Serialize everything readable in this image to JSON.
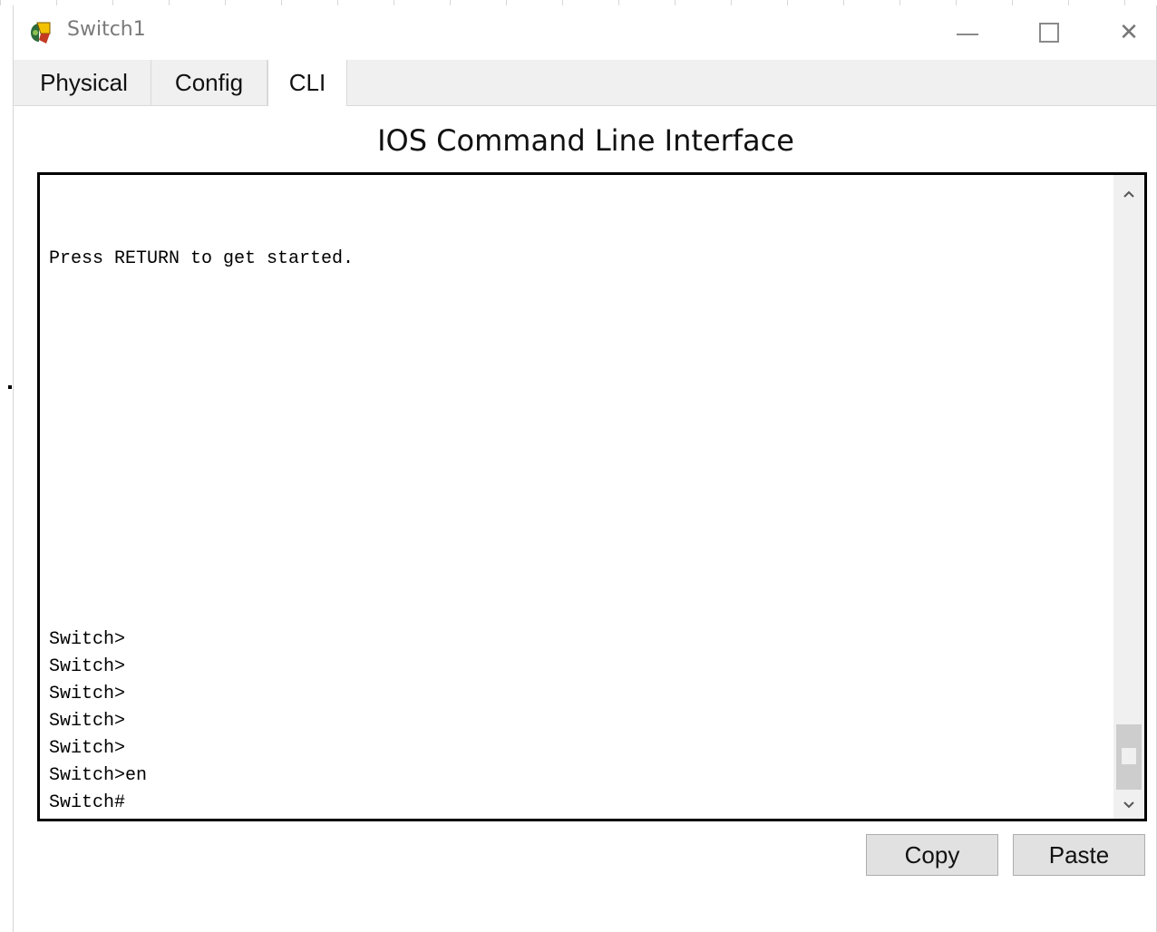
{
  "window": {
    "title": "Switch1",
    "icon": "packet-tracer-switch-icon",
    "controls": {
      "minimize": "minimize-icon",
      "maximize": "maximize-icon",
      "close": "close-icon",
      "close_glyph": "✕"
    }
  },
  "tabs": [
    {
      "label": "Physical",
      "active": false
    },
    {
      "label": "Config",
      "active": false
    },
    {
      "label": "CLI",
      "active": true
    }
  ],
  "heading": "IOS Command Line Interface",
  "terminal": {
    "lines": [
      "Press RETURN to get started.",
      "Switch>",
      "Switch>",
      "Switch>",
      "Switch>",
      "Switch>",
      "Switch>en",
      "Switch#"
    ],
    "scroll_up_glyph": "⌃",
    "scroll_down_glyph": "⌄"
  },
  "buttons": {
    "copy": "Copy",
    "paste": "Paste"
  },
  "colors": {
    "tab_bar": "#f0f0f0",
    "button_bg": "#e1e1e1",
    "terminal_border": "#000000"
  }
}
